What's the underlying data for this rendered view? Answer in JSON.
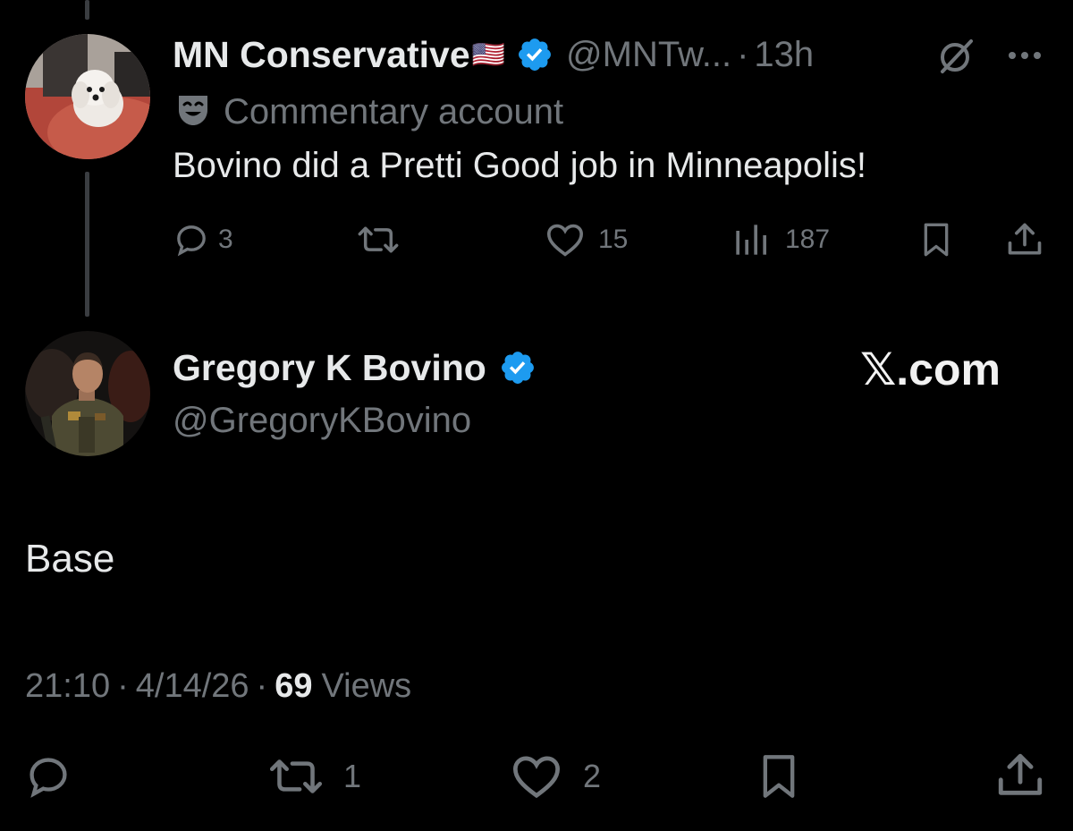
{
  "parent_tweet": {
    "display_name": "MN Conservative",
    "flag": "🇺🇸",
    "handle": "@MNTw...",
    "separator": "·",
    "age": "13h",
    "label_text": "Commentary account",
    "text": "Bovino did a Pretti Good job in Minneapolis!",
    "replies": "3",
    "reposts": "",
    "likes": "15",
    "views": "187",
    "avatar_icon": "dog-avatar",
    "label_icon": "theater-mask-icon"
  },
  "main_tweet": {
    "display_name": "Gregory K Bovino",
    "handle": "@GregoryKBovino",
    "watermark": "𝕏.com",
    "text": "Base",
    "time": "21:10",
    "sep1": "·",
    "date": "4/14/26",
    "sep2": "·",
    "views_count": "69",
    "views_label": "Views",
    "replies": "",
    "reposts": "1",
    "likes": "2",
    "avatar_icon": "person-avatar"
  },
  "colors": {
    "background": "#000000",
    "text": "#e7e9ea",
    "muted": "#71767b",
    "verified": "#1d9bf0"
  }
}
